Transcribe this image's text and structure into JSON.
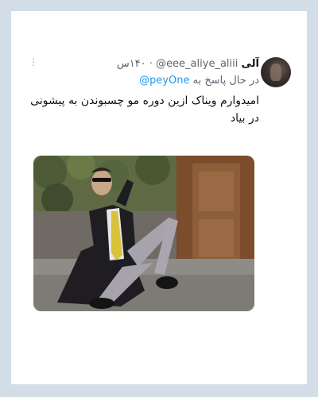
{
  "tweet": {
    "display_name": "آلی",
    "handle": "@eee_aliye_aliii",
    "timestamp": "۱۴۰س",
    "reply_prefix": "در حال پاسخ به",
    "reply_to": "@peyOne",
    "text": "امیدوارم ویناک ازین دوره مو چسبوندن به پیشونی در بیاد",
    "more_icon": "⋮"
  },
  "media": {
    "alt_icon": "photo-icon",
    "colors": {
      "background_wall": "#6e7a4f",
      "door": "#8a5a36",
      "jacket": "#1e1d22",
      "trousers": "#a6a3ad",
      "tie": "#d8c23a",
      "ground": "#8c8a85"
    }
  }
}
